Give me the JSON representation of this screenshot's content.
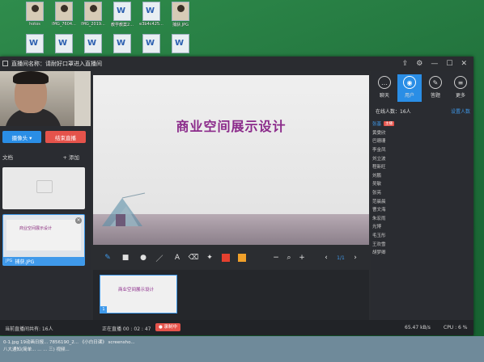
{
  "desktop": {
    "icons": [
      {
        "label": "hotos",
        "type": "photo"
      },
      {
        "label": "IMG_7604...",
        "type": "photo"
      },
      {
        "label": "IMG_2019...",
        "type": "photo"
      },
      {
        "label": "教学教案2...",
        "type": "doc"
      },
      {
        "label": "e3b4c425...",
        "type": "doc"
      },
      {
        "label": "捕获.JPG",
        "type": "photo"
      },
      {
        "label": "",
        "type": "doc"
      },
      {
        "label": "",
        "type": "doc"
      },
      {
        "label": "",
        "type": "doc"
      },
      {
        "label": "",
        "type": "doc"
      },
      {
        "label": "",
        "type": "doc"
      },
      {
        "label": "",
        "type": "doc"
      }
    ]
  },
  "window": {
    "title": "直播间名称：请耐好口罩进入直播间",
    "controls": {
      "share": "⇪",
      "settings": "⚙",
      "minimize": "—",
      "maximize": "☐",
      "close": "✕"
    }
  },
  "left": {
    "camera_button": "摄像头 ▾",
    "end_button": "结束直播",
    "docs_label": "文档",
    "add_label": "+ 添加",
    "file_caption": "捕获.JPG",
    "file_ext": "JPG",
    "slide_thumb_title": "商业空间展示设计"
  },
  "stage": {
    "slide_title": "商业空间展示设计"
  },
  "toolbar": {
    "zoom_minus": "−",
    "zoom_plus": "+",
    "page_prev": "‹",
    "page": "1/1",
    "page_next": "›",
    "colors": {
      "red": "#e5402f",
      "orange": "#f0a02a"
    }
  },
  "filmstrip": {
    "slide_title": "商业空间展示设计",
    "page_num": "1"
  },
  "right": {
    "tabs": [
      {
        "label": "聊天",
        "icon": "chat-icon",
        "glyph": "…"
      },
      {
        "label": "用户",
        "icon": "users-icon",
        "glyph": "👤"
      },
      {
        "label": "答题",
        "icon": "pen-icon",
        "glyph": "✎"
      },
      {
        "label": "更多",
        "icon": "menu-icon",
        "glyph": "≡"
      }
    ],
    "online_label": "在线人数：16人",
    "set_number": "设置人数",
    "users": [
      {
        "name": "张基",
        "badge": "主播"
      },
      {
        "name": "黄雯欣"
      },
      {
        "name": "巴珊珊"
      },
      {
        "name": "李金凤"
      },
      {
        "name": "刘立波"
      },
      {
        "name": "程新旺"
      },
      {
        "name": "刘鹏"
      },
      {
        "name": "吴敏"
      },
      {
        "name": "张亮"
      },
      {
        "name": "范晨晨"
      },
      {
        "name": "曹文海"
      },
      {
        "name": "朱宏雨"
      },
      {
        "name": "光博"
      },
      {
        "name": "毛玉彤"
      },
      {
        "name": "王欢雪"
      },
      {
        "name": "胡梦卿"
      }
    ]
  },
  "status": {
    "viewers": "当前直播间共有: 16人",
    "live_time": "正在直播 00 : 02 : 47",
    "record": "● 录制中",
    "network": "65.47 kB/s",
    "cpu": "CPU : 6 %"
  },
  "taskbar": {
    "line1": "0-1.jpg  19动画日报...  7856190_2...  《小白日课》  screensho...",
    "line2": "八大通知(简单...           ...           ...           三) 视频..."
  }
}
